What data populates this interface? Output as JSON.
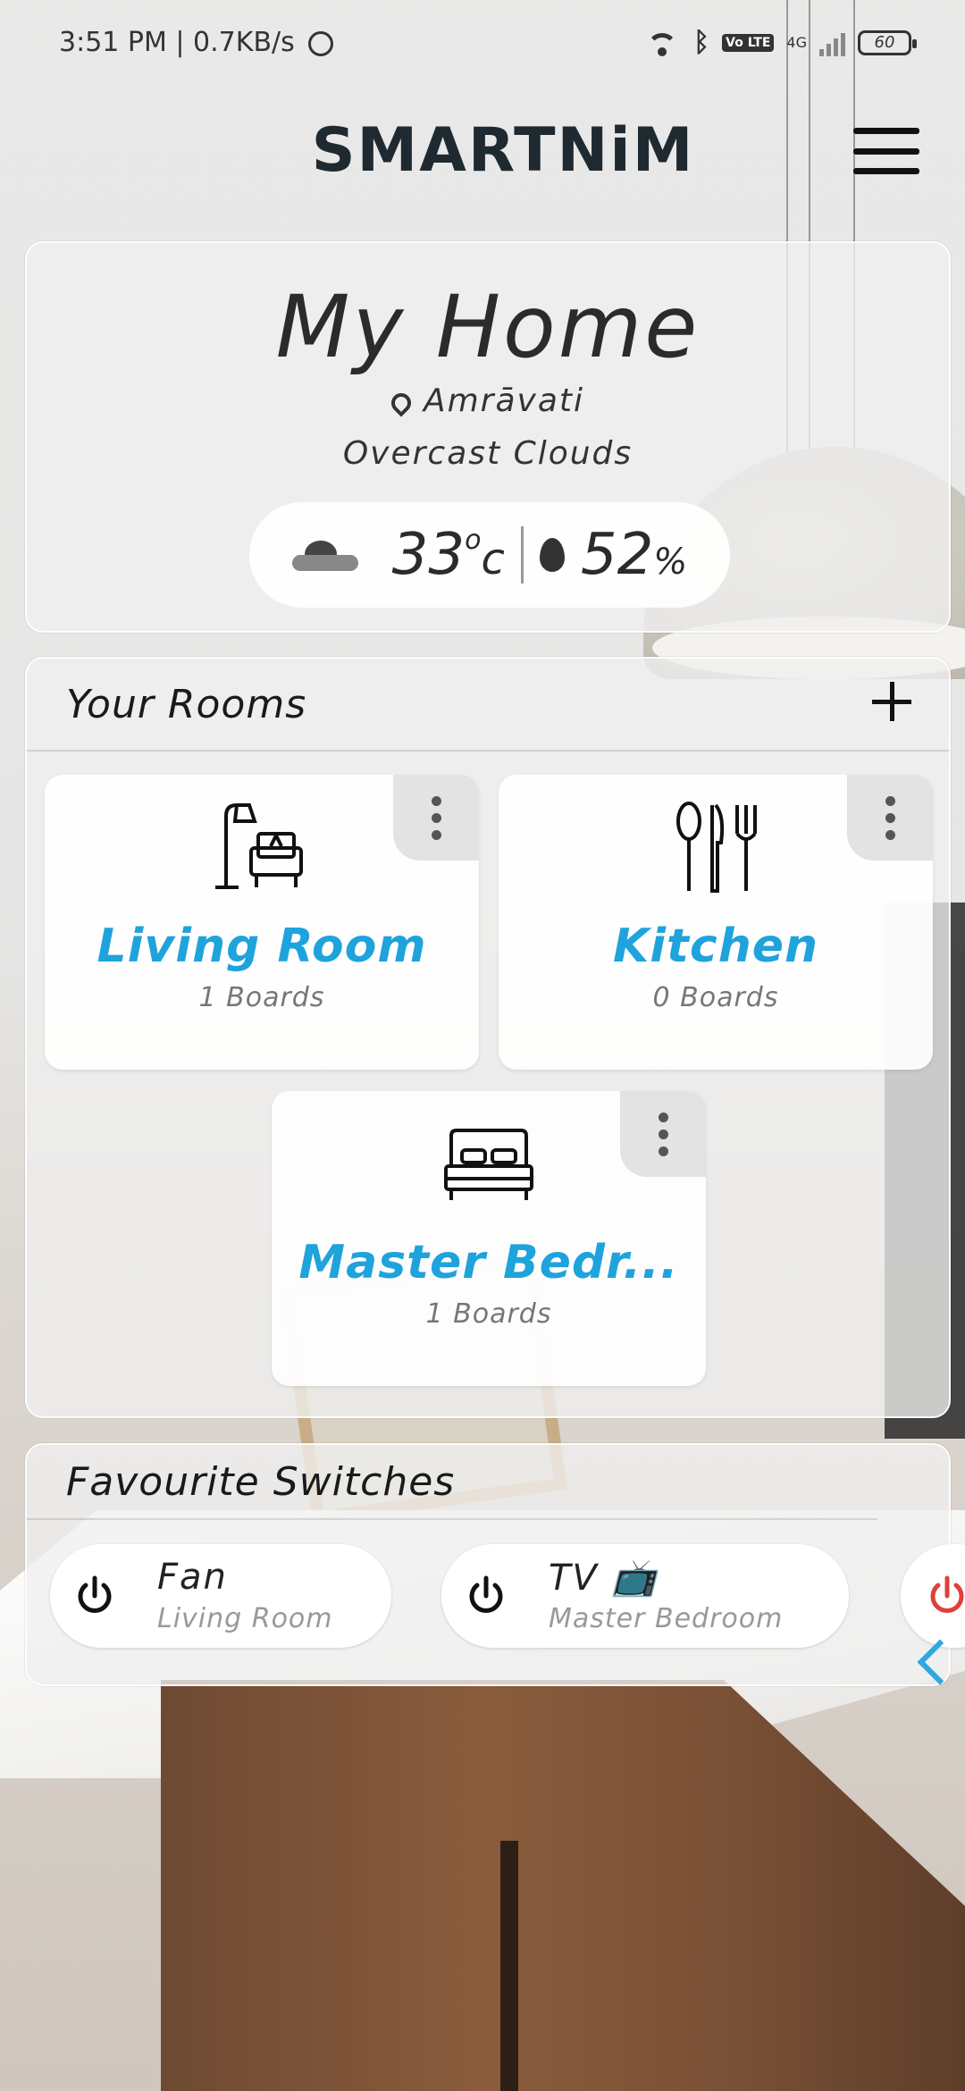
{
  "status_bar": {
    "time_speed": "3:51 PM | 0.7KB/s",
    "network_label": "4G",
    "volte_label": "Vo LTE",
    "battery": "60"
  },
  "header": {
    "logo_text": "SMARTNiM",
    "menu_icon": "hamburger-menu-icon"
  },
  "home": {
    "title": "My Home",
    "location": "Amrāvati",
    "condition": "Overcast Clouds",
    "temperature": "33",
    "temp_unit_deg": "o",
    "temp_unit": "c",
    "humidity": "52",
    "humidity_unit": "%"
  },
  "rooms": {
    "title": "Your Rooms",
    "items": [
      {
        "name": "Living Room",
        "boards": "1 Boards",
        "icon": "living-room-icon"
      },
      {
        "name": "Kitchen",
        "boards": "0 Boards",
        "icon": "kitchen-icon"
      },
      {
        "name": "Master Bedr...",
        "boards": "1 Boards",
        "icon": "bedroom-icon"
      }
    ]
  },
  "favourites": {
    "title": "Favourite Switches",
    "items": [
      {
        "name": "Fan",
        "room": "Living Room"
      },
      {
        "name": "TV 📺",
        "room": "Master Bedroom"
      }
    ]
  },
  "colors": {
    "accent": "#1ea3dc",
    "logo_accent": "#3d9fd8",
    "power_red": "#e0403a"
  }
}
